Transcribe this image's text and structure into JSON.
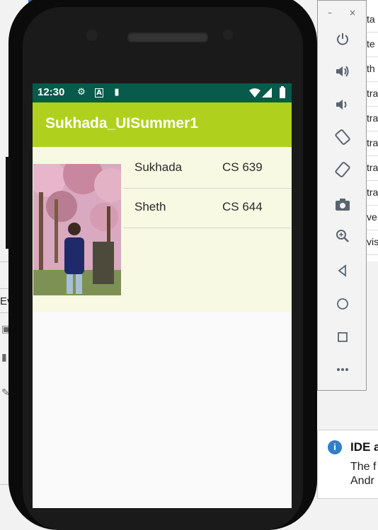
{
  "device": {
    "status_time": "12:30",
    "status_icons": [
      "gear-icon",
      "a-icon",
      "sd-card-icon",
      "wifi-icon",
      "signal-icon",
      "battery-icon"
    ],
    "app_title": "Sukhada_UISummer1",
    "rows": [
      {
        "name": "Sukhada",
        "course": "CS 639"
      },
      {
        "name": "Sheth",
        "course": "CS 644"
      }
    ],
    "colors": {
      "status_bar": "#085a4a",
      "app_bar": "#afd11d",
      "content_bg": "#f7f9e2"
    }
  },
  "ide": {
    "left_label": "Ev",
    "right_items": [
      "ta",
      "te",
      "th",
      "tra",
      "tra",
      "tra",
      "tra",
      "tra",
      "ve",
      "vis"
    ]
  },
  "emulator_toolbar": {
    "window_controls": [
      "minimize-icon",
      "close-icon"
    ],
    "buttons": [
      "power-icon",
      "volume-up-icon",
      "volume-down-icon",
      "rotate-left-icon",
      "rotate-right-icon",
      "camera-icon",
      "zoom-icon",
      "back-icon",
      "home-icon",
      "overview-icon",
      "more-icon"
    ]
  },
  "notification": {
    "title": "IDE a",
    "body_line1": "The f",
    "body_line2": "Andr"
  }
}
